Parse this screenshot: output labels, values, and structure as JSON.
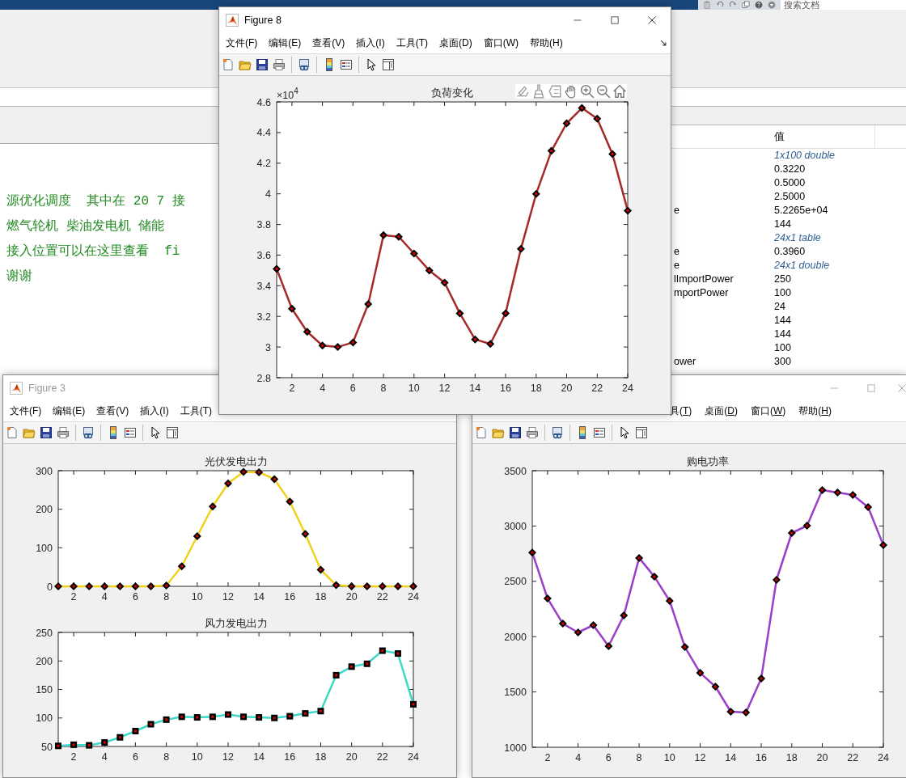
{
  "main_window": {
    "search": {
      "placeholder": "搜索文档"
    }
  },
  "editor": {
    "lines": [
      "源优化调度  其中在 20 7 接",
      "燃气轮机 柴油发电机 储能",
      "接入位置可以在这里查看  fi",
      "谢谢"
    ]
  },
  "workspace": {
    "value_header": "值",
    "rows": [
      {
        "value": "1x100 double",
        "kind": "summary"
      },
      {
        "value": "0.3220",
        "kind": "scalar"
      },
      {
        "value": "0.5000",
        "kind": "scalar"
      },
      {
        "value": "2.5000",
        "kind": "scalar"
      },
      {
        "name": "e",
        "value": "5.2265e+04",
        "kind": "scalar"
      },
      {
        "value": "144",
        "kind": "scalar"
      },
      {
        "value": "24x1 table",
        "kind": "summary"
      },
      {
        "name": "e",
        "value": "0.3960",
        "kind": "scalar"
      },
      {
        "name": "e",
        "value": "24x1 double",
        "kind": "summary"
      },
      {
        "name": "lImportPower",
        "value": "250",
        "kind": "scalar"
      },
      {
        "name": "mportPower",
        "value": "100",
        "kind": "scalar"
      },
      {
        "value": "24",
        "kind": "scalar"
      },
      {
        "value": "144",
        "kind": "scalar"
      },
      {
        "value": "144",
        "kind": "scalar"
      },
      {
        "value": "100",
        "kind": "scalar"
      },
      {
        "name": "ower",
        "value": "300",
        "kind": "scalar"
      }
    ]
  },
  "figures": [
    {
      "title": "Figure 8",
      "active": true,
      "mnemonic_underline": false,
      "menu": [
        "文件(F)",
        "编辑(E)",
        "查看(V)",
        "插入(I)",
        "工具(T)",
        "桌面(D)",
        "窗口(W)",
        "帮助(H)"
      ],
      "axes": [
        {
          "exponent_label": {
            "base": "×10",
            "power": "4"
          },
          "chart_data": {
            "type": "line",
            "title": "负荷变化",
            "x": [
              1,
              2,
              3,
              4,
              5,
              6,
              7,
              8,
              9,
              10,
              11,
              12,
              13,
              14,
              15,
              16,
              17,
              18,
              19,
              20,
              21,
              22,
              23,
              24
            ],
            "xlim": [
              1,
              24
            ],
            "ylim": [
              2.8,
              4.6
            ],
            "xticks": [
              2,
              4,
              6,
              8,
              10,
              12,
              14,
              16,
              18,
              20,
              22,
              24
            ],
            "yticks": [
              2.8,
              3,
              3.2,
              3.4,
              3.6,
              3.8,
              4,
              4.2,
              4.4,
              4.6
            ],
            "series": [
              {
                "color": "#a52a2a",
                "marker": "diamond",
                "values": [
                  3.51,
                  3.25,
                  3.1,
                  3.01,
                  3.0,
                  3.03,
                  3.28,
                  3.73,
                  3.72,
                  3.61,
                  3.5,
                  3.42,
                  3.22,
                  3.05,
                  3.02,
                  3.22,
                  3.64,
                  4.0,
                  4.28,
                  4.46,
                  4.56,
                  4.49,
                  4.26,
                  3.89
                ]
              }
            ]
          }
        }
      ]
    },
    {
      "title": "Figure 3",
      "active": false,
      "mnemonic_underline": false,
      "menu": [
        "文件(F)",
        "编辑(E)",
        "查看(V)",
        "插入(I)",
        "工具(T)"
      ],
      "axes": [
        {
          "chart_data": {
            "type": "line",
            "title": "光伏发电出力",
            "x": [
              1,
              2,
              3,
              4,
              5,
              6,
              7,
              8,
              9,
              10,
              11,
              12,
              13,
              14,
              15,
              16,
              17,
              18,
              19,
              20,
              21,
              22,
              23,
              24
            ],
            "xlim": [
              1,
              24
            ],
            "ylim": [
              0,
              300
            ],
            "xticks": [
              2,
              4,
              6,
              8,
              10,
              12,
              14,
              16,
              18,
              20,
              22,
              24
            ],
            "yticks": [
              0,
              100,
              200,
              300
            ],
            "series": [
              {
                "color": "#f0d21e",
                "marker": "diamond",
                "values": [
                  0,
                  0,
                  0,
                  0,
                  0,
                  0,
                  0,
                  2,
                  52,
                  130,
                  207,
                  267,
                  297,
                  296,
                  278,
                  220,
                  136,
                  43,
                  3,
                  0,
                  0,
                  0,
                  0,
                  0
                ]
              }
            ]
          }
        },
        {
          "chart_data": {
            "type": "line",
            "title": "风力发电出力",
            "x": [
              1,
              2,
              3,
              4,
              5,
              6,
              7,
              8,
              9,
              10,
              11,
              12,
              13,
              14,
              15,
              16,
              17,
              18,
              19,
              20,
              21,
              22,
              23,
              24
            ],
            "xlim": [
              1,
              24
            ],
            "ylim": [
              50,
              250
            ],
            "xticks": [
              2,
              4,
              6,
              8,
              10,
              12,
              14,
              16,
              18,
              20,
              22,
              24
            ],
            "yticks": [
              50,
              100,
              150,
              200,
              250
            ],
            "series": [
              {
                "color": "#40d8c8",
                "marker": "square",
                "values": [
                  51,
                  53,
                  52,
                  57,
                  66,
                  77,
                  89,
                  97,
                  102,
                  101,
                  102,
                  106,
                  102,
                  101,
                  100,
                  103,
                  108,
                  112,
                  175,
                  190,
                  195,
                  218,
                  213,
                  124
                ]
              }
            ]
          }
        }
      ]
    },
    {
      "active": false,
      "mnemonic_underline": true,
      "menu": [
        "具(T)",
        "桌面(D)",
        "窗口(W)",
        "帮助(H)"
      ],
      "axes": [
        {
          "chart_data": {
            "type": "line",
            "title": "购电功率",
            "x": [
              1,
              2,
              3,
              4,
              5,
              6,
              7,
              8,
              9,
              10,
              11,
              12,
              13,
              14,
              15,
              16,
              17,
              18,
              19,
              20,
              21,
              22,
              23,
              24
            ],
            "xlim": [
              1,
              24
            ],
            "ylim": [
              1000,
              3500
            ],
            "xticks": [
              2,
              4,
              6,
              8,
              10,
              12,
              14,
              16,
              18,
              20,
              22,
              24
            ],
            "yticks": [
              1000,
              1500,
              2000,
              2500,
              3000,
              3500
            ],
            "series": [
              {
                "color": "#9a40c8",
                "marker": "diamond",
                "values": [
                  2760,
                  2345,
                  2118,
                  2038,
                  2104,
                  1914,
                  2192,
                  2711,
                  2542,
                  2323,
                  1906,
                  1672,
                  1548,
                  1322,
                  1314,
                  1621,
                  2513,
                  2937,
                  3003,
                  3325,
                  3303,
                  3281,
                  3171,
                  2827
                ]
              }
            ]
          }
        }
      ]
    }
  ]
}
